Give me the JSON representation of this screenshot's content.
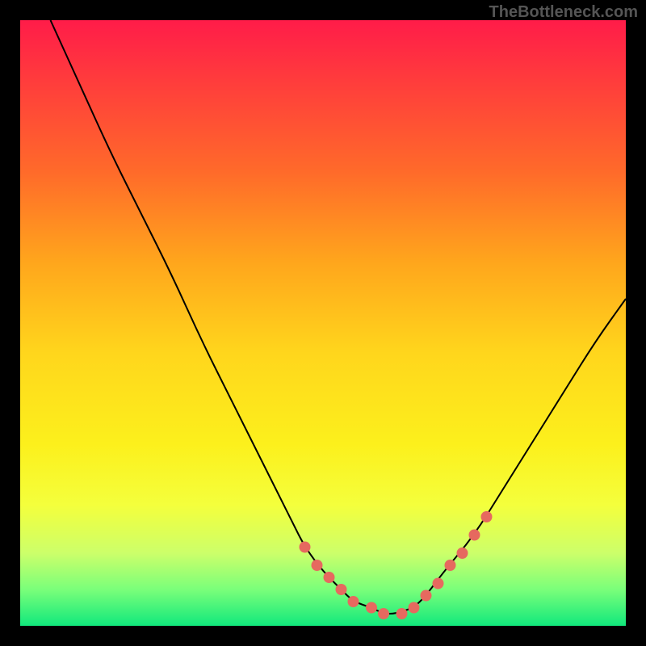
{
  "attribution": "TheBottleneck.com",
  "chart_data": {
    "type": "line",
    "title": "",
    "xlabel": "",
    "ylabel": "",
    "xlim": [
      0,
      100
    ],
    "ylim": [
      0,
      100
    ],
    "series": [
      {
        "name": "bottleneck-curve",
        "x": [
          5,
          10,
          15,
          20,
          25,
          30,
          35,
          40,
          45,
          47,
          50,
          53,
          55,
          58,
          60,
          62,
          65,
          67,
          70,
          75,
          80,
          85,
          90,
          95,
          100
        ],
        "y": [
          100,
          89,
          78,
          68,
          58,
          47,
          37,
          27,
          17,
          13,
          9,
          6,
          4,
          3,
          2,
          2,
          3,
          5,
          9,
          15,
          23,
          31,
          39,
          47,
          54
        ]
      }
    ],
    "markers": {
      "name": "highlight-dots",
      "x": [
        47,
        49,
        51,
        53,
        55,
        58,
        60,
        63,
        65,
        67,
        69,
        71,
        73,
        75,
        77
      ],
      "y": [
        13,
        10,
        8,
        6,
        4,
        3,
        2,
        2,
        3,
        5,
        7,
        10,
        12,
        15,
        18
      ]
    },
    "gradient_stops": [
      {
        "pos": 0,
        "color": "#ff1c49"
      },
      {
        "pos": 25,
        "color": "#ff6a2a"
      },
      {
        "pos": 55,
        "color": "#ffd61c"
      },
      {
        "pos": 80,
        "color": "#f4ff3c"
      },
      {
        "pos": 100,
        "color": "#11e87c"
      }
    ]
  }
}
